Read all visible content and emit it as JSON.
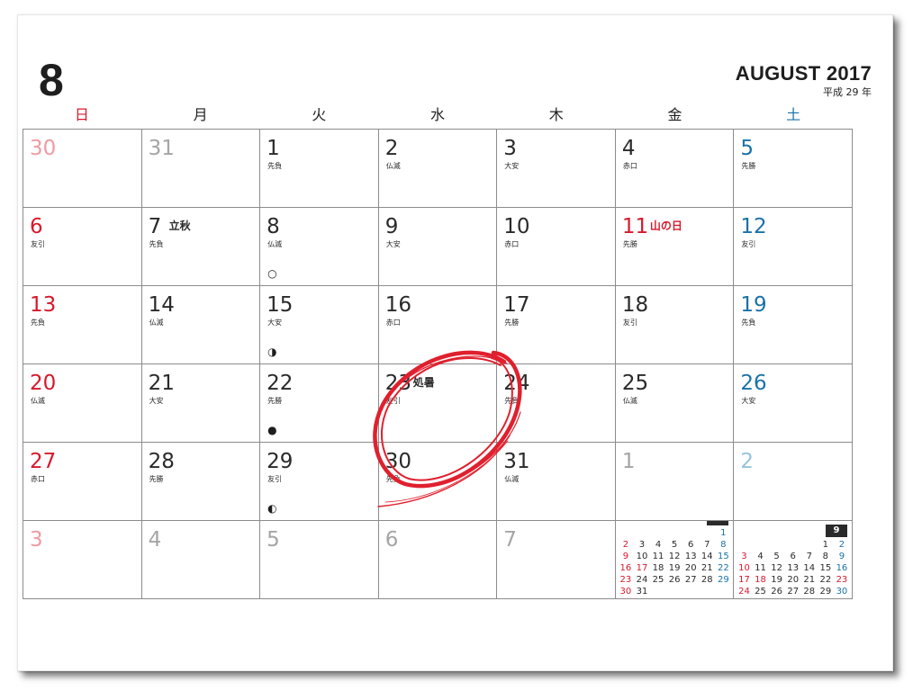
{
  "header": {
    "month_number": "8",
    "month_name": "AUGUST 2017",
    "era_year": "平成 29 年"
  },
  "weekdays": [
    "日",
    "月",
    "火",
    "水",
    "木",
    "金",
    "土"
  ],
  "colors": {
    "sunday": "#d7192c",
    "saturday": "#1a72a8",
    "ink": "#2a2a2a",
    "circle": "#e0202e"
  },
  "weeks": [
    [
      {
        "day": "30",
        "out": true
      },
      {
        "day": "31",
        "out": true
      },
      {
        "day": "1",
        "rokuyo": "先負"
      },
      {
        "day": "2",
        "rokuyo": "仏滅"
      },
      {
        "day": "3",
        "rokuyo": "大安"
      },
      {
        "day": "4",
        "rokuyo": "赤口"
      },
      {
        "day": "5",
        "rokuyo": "先勝"
      }
    ],
    [
      {
        "day": "6",
        "rokuyo": "友引"
      },
      {
        "day": "7",
        "rokuyo": "先負",
        "holiday_name": "立秋"
      },
      {
        "day": "8",
        "rokuyo": "仏滅",
        "moon": "○"
      },
      {
        "day": "9",
        "rokuyo": "大安"
      },
      {
        "day": "10",
        "rokuyo": "赤口"
      },
      {
        "day": "11",
        "rokuyo": "先勝",
        "holiday_name": "山の日",
        "holiday": true
      },
      {
        "day": "12",
        "rokuyo": "友引"
      }
    ],
    [
      {
        "day": "13",
        "rokuyo": "先負"
      },
      {
        "day": "14",
        "rokuyo": "仏滅"
      },
      {
        "day": "15",
        "rokuyo": "大安",
        "moon": "◑"
      },
      {
        "day": "16",
        "rokuyo": "赤口"
      },
      {
        "day": "17",
        "rokuyo": "先勝"
      },
      {
        "day": "18",
        "rokuyo": "友引"
      },
      {
        "day": "19",
        "rokuyo": "先負"
      }
    ],
    [
      {
        "day": "20",
        "rokuyo": "仏滅"
      },
      {
        "day": "21",
        "rokuyo": "大安"
      },
      {
        "day": "22",
        "rokuyo": "先勝",
        "moon": "●"
      },
      {
        "day": "23",
        "rokuyo": "友引",
        "holiday_name": "処暑"
      },
      {
        "day": "24",
        "rokuyo": "先負"
      },
      {
        "day": "25",
        "rokuyo": "仏滅"
      },
      {
        "day": "26",
        "rokuyo": "大安"
      }
    ],
    [
      {
        "day": "27",
        "rokuyo": "赤口"
      },
      {
        "day": "28",
        "rokuyo": "先勝"
      },
      {
        "day": "29",
        "rokuyo": "友引",
        "moon": "◐"
      },
      {
        "day": "30",
        "rokuyo": "先負"
      },
      {
        "day": "31",
        "rokuyo": "仏滅"
      },
      {
        "day": "1",
        "out": true
      },
      {
        "day": "2",
        "out": true
      }
    ],
    [
      {
        "day": "3",
        "out": true
      },
      {
        "day": "4",
        "out": true
      },
      {
        "day": "5",
        "out": true
      },
      {
        "day": "6",
        "out": true
      },
      {
        "day": "7",
        "out": true
      },
      {
        "mini_index": 0
      },
      {
        "mini_index": 1
      }
    ]
  ],
  "mini_calendars": [
    {
      "badge": "7",
      "rows": [
        [
          "",
          "",
          "",
          "",
          "",
          "",
          "1"
        ],
        [
          "2",
          "3",
          "4",
          "5",
          "6",
          "7",
          "8"
        ],
        [
          "9",
          "10",
          "11",
          "12",
          "13",
          "14",
          "15"
        ],
        [
          "16",
          "17",
          "18",
          "19",
          "20",
          "21",
          "22"
        ],
        [
          "23",
          "24",
          "25",
          "26",
          "27",
          "28",
          "29"
        ],
        [
          "30",
          "31",
          "",
          "",
          "",
          "",
          ""
        ]
      ],
      "red_days": [
        "17"
      ]
    },
    {
      "badge": "9",
      "rows": [
        [
          "",
          "",
          "",
          "",
          "",
          "1",
          "2"
        ],
        [
          "3",
          "4",
          "5",
          "6",
          "7",
          "8",
          "9"
        ],
        [
          "10",
          "11",
          "12",
          "13",
          "14",
          "15",
          "16"
        ],
        [
          "17",
          "18",
          "19",
          "20",
          "21",
          "22",
          "23"
        ],
        [
          "24",
          "25",
          "26",
          "27",
          "28",
          "29",
          "30"
        ]
      ],
      "red_days": [
        "18",
        "23"
      ]
    }
  ]
}
